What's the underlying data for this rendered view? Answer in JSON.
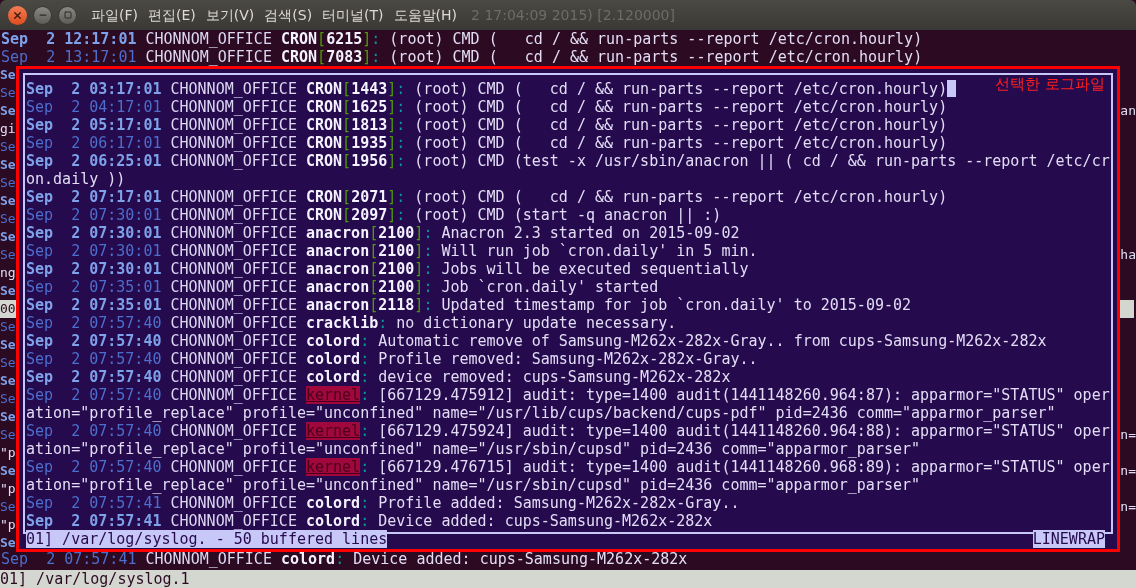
{
  "window": {
    "title": "2 17:04:09 2015) [2.120000]",
    "menu": [
      "파일(F)",
      "편집(E)",
      "보기(V)",
      "검색(S)",
      "터미널(T)",
      "도움말(H)"
    ]
  },
  "terminal_top": [
    {
      "dim": false,
      "date": "Sep  2 12:17:01",
      "host": "CHONNOM_OFFICE",
      "program": "CRON",
      "pid": "[6215]",
      "message": ": (root) CMD (   cd / && run-parts --report /etc/cron.hourly)"
    },
    {
      "dim": true,
      "date": "Sep  2 13:17:01",
      "host": "CHONNOM_OFFICE",
      "program": "CRON",
      "pid": "[7083]",
      "message": ": (root) CMD (   cd / && run-parts --report /etc/cron.hourly)"
    }
  ],
  "side_rows": [
    {
      "left": {
        "text": "Se",
        "kind": "bright"
      }
    },
    {
      "left": {
        "text": "Se",
        "kind": "dim"
      }
    },
    {
      "left": {
        "text": "Se",
        "kind": "bright"
      },
      "right": {
        "text": "an",
        "kind": "plain"
      }
    },
    {
      "left": {
        "text": "gi",
        "kind": "plain"
      }
    },
    {
      "left": {
        "text": "Se",
        "kind": "dim"
      }
    },
    {
      "left": {
        "text": "Se",
        "kind": "bright"
      }
    },
    {
      "left": {
        "text": "Se",
        "kind": "dim"
      }
    },
    {
      "left": {
        "text": "Se",
        "kind": "bright"
      }
    },
    {
      "left": {
        "text": "Se",
        "kind": "dim"
      }
    },
    {
      "left": {
        "text": "Se",
        "kind": "bright"
      }
    },
    {
      "left": {
        "text": "Se",
        "kind": "dim"
      },
      "right": {
        "text": "ha",
        "kind": "plain"
      }
    },
    {
      "left": {
        "text": "ng",
        "kind": "plain"
      }
    },
    {
      "left": {
        "text": "Se",
        "kind": "bright"
      }
    },
    {
      "left": {
        "text": "00",
        "kind": "highlight"
      },
      "right": {
        "kind": "highlight"
      }
    },
    {
      "left": {
        "text": "Se",
        "kind": "dim"
      }
    },
    {
      "left": {
        "text": "Se",
        "kind": "bright"
      }
    },
    {
      "left": {
        "text": "Se",
        "kind": "dim"
      }
    },
    {
      "left": {
        "text": "Se",
        "kind": "bright"
      }
    },
    {
      "left": {
        "text": "Se",
        "kind": "dim"
      }
    },
    {
      "left": {
        "text": "Se",
        "kind": "bright"
      }
    },
    {
      "left": {
        "text": "Se",
        "kind": "dim"
      },
      "right": {
        "text": "n=",
        "kind": "plain"
      }
    },
    {
      "left": {
        "text": "\"p",
        "kind": "plain"
      }
    },
    {
      "left": {
        "text": "Se",
        "kind": "bright"
      },
      "right": {
        "text": "n=",
        "kind": "plain"
      }
    },
    {
      "left": {
        "text": "\"p",
        "kind": "plain"
      }
    },
    {
      "left": {
        "text": "Se",
        "kind": "dim"
      },
      "right": {
        "text": "n=",
        "kind": "plain"
      }
    },
    {
      "left": {
        "text": "\"p",
        "kind": "plain"
      }
    },
    {
      "left": {
        "text": "Se",
        "kind": "bright"
      }
    }
  ],
  "popup": {
    "annotation": "선택한 로그파일",
    "status": "01] /var/log/syslog. - 50 buffered lines",
    "mode": "LINEWRAP",
    "lines": [
      {
        "kind": "entry",
        "dim": false,
        "cursor": true,
        "highlighted": false,
        "date": "Sep  2 03:17:01",
        "host": "CHONNOM_OFFICE",
        "program": "CRON",
        "pid": "[1443]",
        "message": ": (root) CMD (   cd / && run-parts --report /etc/cron.hourly)"
      },
      {
        "kind": "entry",
        "dim": true,
        "cursor": false,
        "highlighted": false,
        "date": "Sep  2 04:17:01",
        "host": "CHONNOM_OFFICE",
        "program": "CRON",
        "pid": "[1625]",
        "message": ": (root) CMD (   cd / && run-parts --report /etc/cron.hourly)"
      },
      {
        "kind": "entry",
        "dim": false,
        "cursor": false,
        "highlighted": false,
        "date": "Sep  2 05:17:01",
        "host": "CHONNOM_OFFICE",
        "program": "CRON",
        "pid": "[1813]",
        "message": ": (root) CMD (   cd / && run-parts --report /etc/cron.hourly)"
      },
      {
        "kind": "entry",
        "dim": true,
        "cursor": false,
        "highlighted": false,
        "date": "Sep  2 06:17:01",
        "host": "CHONNOM_OFFICE",
        "program": "CRON",
        "pid": "[1935]",
        "message": ": (root) CMD (   cd / && run-parts --report /etc/cron.hourly)"
      },
      {
        "kind": "entry",
        "dim": false,
        "cursor": false,
        "highlighted": false,
        "date": "Sep  2 06:25:01",
        "host": "CHONNOM_OFFICE",
        "program": "CRON",
        "pid": "[1956]",
        "message": ": (root) CMD (test -x /usr/sbin/anacron || ( cd / && run-parts --report /etc/cr"
      },
      {
        "kind": "continuation",
        "cursor": false,
        "text": "on.daily ))"
      },
      {
        "kind": "entry",
        "dim": false,
        "cursor": false,
        "highlighted": false,
        "date": "Sep  2 07:17:01",
        "host": "CHONNOM_OFFICE",
        "program": "CRON",
        "pid": "[2071]",
        "message": ": (root) CMD (   cd / && run-parts --report /etc/cron.hourly)"
      },
      {
        "kind": "entry",
        "dim": true,
        "cursor": false,
        "highlighted": false,
        "date": "Sep  2 07:30:01",
        "host": "CHONNOM_OFFICE",
        "program": "CRON",
        "pid": "[2097]",
        "message": ": (root) CMD (start -q anacron || :)"
      },
      {
        "kind": "entry",
        "dim": false,
        "cursor": false,
        "highlighted": false,
        "date": "Sep  2 07:30:01",
        "host": "CHONNOM_OFFICE",
        "program": "anacron",
        "pid": "[2100]",
        "message": ": Anacron 2.3 started on 2015-09-02"
      },
      {
        "kind": "entry",
        "dim": true,
        "cursor": false,
        "highlighted": false,
        "date": "Sep  2 07:30:01",
        "host": "CHONNOM_OFFICE",
        "program": "anacron",
        "pid": "[2100]",
        "message": ": Will run job `cron.daily' in 5 min."
      },
      {
        "kind": "entry",
        "dim": false,
        "cursor": false,
        "highlighted": false,
        "date": "Sep  2 07:30:01",
        "host": "CHONNOM_OFFICE",
        "program": "anacron",
        "pid": "[2100]",
        "message": ": Jobs will be executed sequentially"
      },
      {
        "kind": "entry",
        "dim": true,
        "cursor": false,
        "highlighted": false,
        "date": "Sep  2 07:35:01",
        "host": "CHONNOM_OFFICE",
        "program": "anacron",
        "pid": "[2100]",
        "message": ": Job `cron.daily' started"
      },
      {
        "kind": "entry",
        "dim": false,
        "cursor": false,
        "highlighted": false,
        "date": "Sep  2 07:35:01",
        "host": "CHONNOM_OFFICE",
        "program": "anacron",
        "pid": "[2118]",
        "message": ": Updated timestamp for job `cron.daily' to 2015-09-02"
      },
      {
        "kind": "entry",
        "dim": true,
        "cursor": false,
        "highlighted": false,
        "date": "Sep  2 07:57:40",
        "host": "CHONNOM_OFFICE",
        "program": "cracklib",
        "message": ": no dictionary update necessary."
      },
      {
        "kind": "entry",
        "dim": false,
        "cursor": false,
        "highlighted": false,
        "date": "Sep  2 07:57:40",
        "host": "CHONNOM_OFFICE",
        "program": "colord",
        "message": ": Automatic remove of Samsung-M262x-282x-Gray.. from cups-Samsung-M262x-282x"
      },
      {
        "kind": "entry",
        "dim": true,
        "cursor": false,
        "highlighted": false,
        "date": "Sep  2 07:57:40",
        "host": "CHONNOM_OFFICE",
        "program": "colord",
        "message": ": Profile removed: Samsung-M262x-282x-Gray.."
      },
      {
        "kind": "entry",
        "dim": false,
        "cursor": false,
        "highlighted": false,
        "date": "Sep  2 07:57:40",
        "host": "CHONNOM_OFFICE",
        "program": "colord",
        "message": ": device removed: cups-Samsung-M262x-282x"
      },
      {
        "kind": "entry",
        "dim": true,
        "cursor": false,
        "highlighted": true,
        "date": "Sep  2 07:57:40",
        "host": "CHONNOM_OFFICE",
        "program": "kernel",
        "message": ": [667129.475912] audit: type=1400 audit(1441148260.964:87): apparmor=\"STATUS\" oper"
      },
      {
        "kind": "continuation",
        "cursor": false,
        "text": "ation=\"profile_replace\" profile=\"unconfined\" name=\"/usr/lib/cups/backend/cups-pdf\" pid=2436 comm=\"apparmor_parser\""
      },
      {
        "kind": "entry",
        "dim": true,
        "cursor": false,
        "highlighted": true,
        "date": "Sep  2 07:57:40",
        "host": "CHONNOM_OFFICE",
        "program": "kernel",
        "message": ": [667129.475924] audit: type=1400 audit(1441148260.964:88): apparmor=\"STATUS\" oper"
      },
      {
        "kind": "continuation",
        "cursor": false,
        "text": "ation=\"profile_replace\" profile=\"unconfined\" name=\"/usr/sbin/cupsd\" pid=2436 comm=\"apparmor_parser\""
      },
      {
        "kind": "entry",
        "dim": true,
        "cursor": false,
        "highlighted": true,
        "date": "Sep  2 07:57:40",
        "host": "CHONNOM_OFFICE",
        "program": "kernel",
        "message": ": [667129.476715] audit: type=1400 audit(1441148260.968:89): apparmor=\"STATUS\" oper"
      },
      {
        "kind": "continuation",
        "cursor": false,
        "text": "ation=\"profile_replace\" profile=\"unconfined\" name=\"/usr/sbin/cupsd\" pid=2436 comm=\"apparmor_parser\""
      },
      {
        "kind": "entry",
        "dim": true,
        "cursor": false,
        "highlighted": false,
        "date": "Sep  2 07:57:41",
        "host": "CHONNOM_OFFICE",
        "program": "colord",
        "message": ": Profile added: Samsung-M262x-282x-Gray.."
      },
      {
        "kind": "entry",
        "dim": false,
        "cursor": false,
        "highlighted": false,
        "date": "Sep  2 07:57:41",
        "host": "CHONNOM_OFFICE",
        "program": "colord",
        "message": ": Device added: cups-Samsung-M262x-282x"
      }
    ]
  },
  "terminal_bottom": [
    {
      "dim": true,
      "date": "Sep  2 07:57:41",
      "host": "CHONNOM_OFFICE",
      "program": "colord",
      "message": ": Device added: cups-Samsung-M262x-282x"
    }
  ],
  "status_bar": "01] /var/log/syslog.1"
}
